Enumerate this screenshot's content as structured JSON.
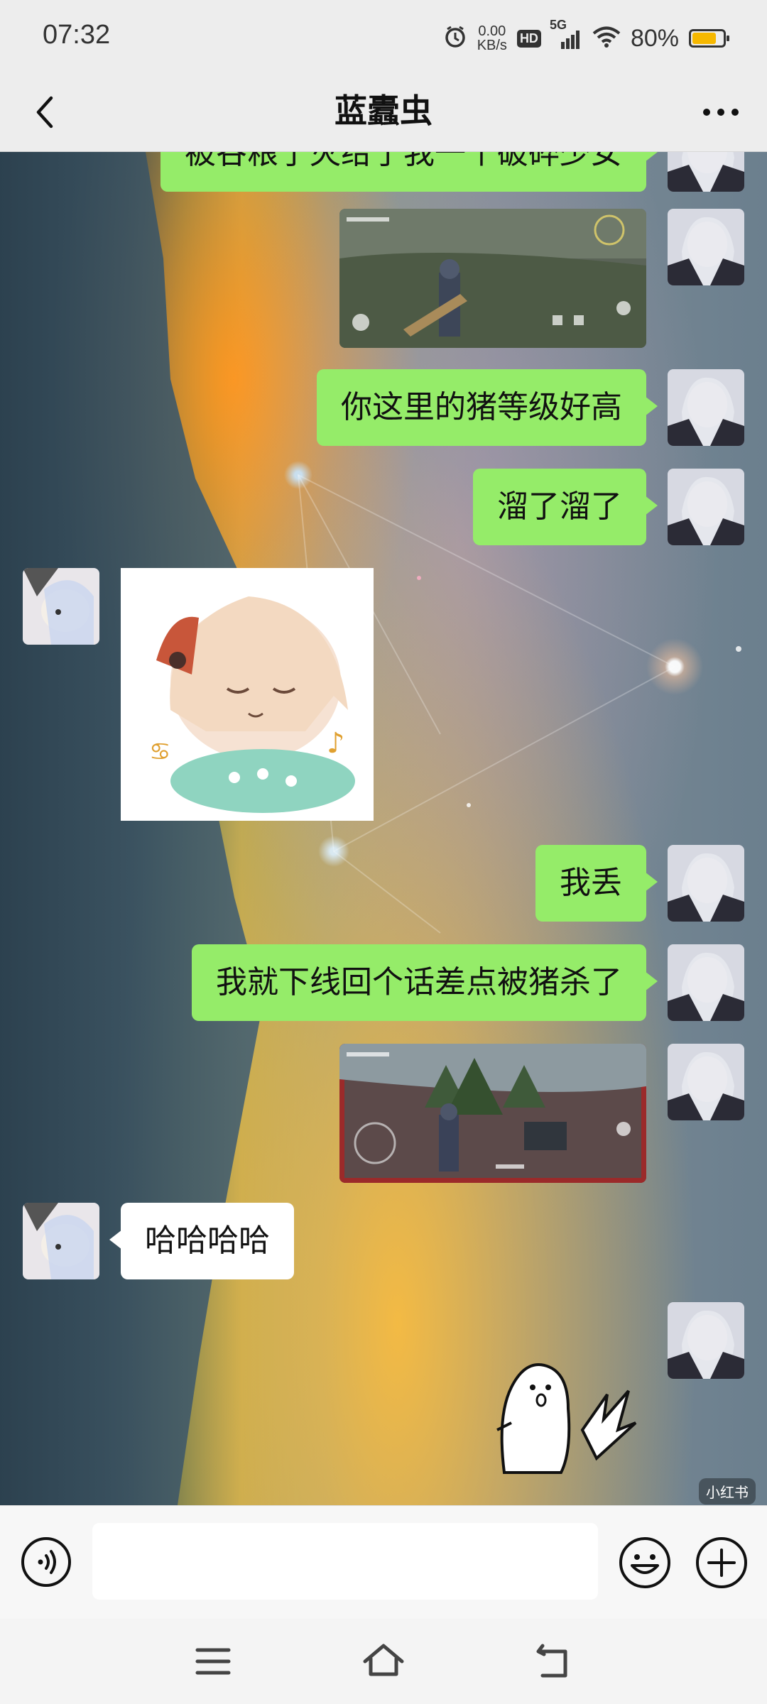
{
  "status_bar": {
    "time": "07:32",
    "net_speed_value": "0.00",
    "net_speed_unit": "KB/s",
    "hd_label": "HD",
    "network": "5G",
    "battery_percent": "80%",
    "battery_level": 0.8,
    "battery_color": "#f6b800",
    "icons": [
      "alarm-icon",
      "hd-icon",
      "signal-icon",
      "wifi-icon",
      "battery-icon"
    ]
  },
  "header": {
    "title": "蓝蠹虫",
    "back_icon": "chevron-left-icon",
    "more_icon": "more-dots-icon"
  },
  "messages": [
    {
      "from": "me",
      "type": "text",
      "text": "被谷粮了灭给了我一个破碎少女",
      "partially_visible": true
    },
    {
      "from": "me",
      "type": "image",
      "content": "game-screenshot"
    },
    {
      "from": "me",
      "type": "text",
      "text": "你这里的猪等级好高"
    },
    {
      "from": "me",
      "type": "text",
      "text": "溜了溜了"
    },
    {
      "from": "them",
      "type": "sticker",
      "content": "anime-sleeping-girl-sticker"
    },
    {
      "from": "me",
      "type": "text",
      "text": "我丢"
    },
    {
      "from": "me",
      "type": "text",
      "text": "我就下线回个话差点被猪杀了"
    },
    {
      "from": "me",
      "type": "image",
      "content": "game-screenshot"
    },
    {
      "from": "them",
      "type": "text",
      "text": "哈哈哈哈"
    },
    {
      "from": "me",
      "type": "sticker",
      "content": "shocked-blob-sticker"
    }
  ],
  "watermark": "小红书",
  "input_bar": {
    "value": "",
    "placeholder": "",
    "voice_icon": "voice-icon",
    "emoji_icon": "emoji-icon",
    "plus_icon": "plus-icon"
  },
  "nav_bar": {
    "icons": [
      "menu-icon",
      "home-icon",
      "back-icon"
    ]
  },
  "colors": {
    "my_bubble": "#95ec69",
    "their_bubble": "#ffffff",
    "bar_background": "#ededed"
  }
}
